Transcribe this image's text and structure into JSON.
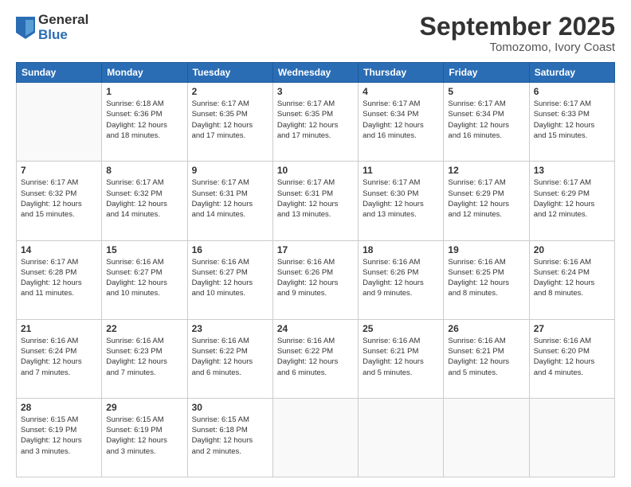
{
  "header": {
    "logo_general": "General",
    "logo_blue": "Blue",
    "month_title": "September 2025",
    "location": "Tomozomo, Ivory Coast"
  },
  "days_of_week": [
    "Sunday",
    "Monday",
    "Tuesday",
    "Wednesday",
    "Thursday",
    "Friday",
    "Saturday"
  ],
  "weeks": [
    [
      {
        "day": "",
        "detail": ""
      },
      {
        "day": "1",
        "detail": "Sunrise: 6:18 AM\nSunset: 6:36 PM\nDaylight: 12 hours\nand 18 minutes."
      },
      {
        "day": "2",
        "detail": "Sunrise: 6:17 AM\nSunset: 6:35 PM\nDaylight: 12 hours\nand 17 minutes."
      },
      {
        "day": "3",
        "detail": "Sunrise: 6:17 AM\nSunset: 6:35 PM\nDaylight: 12 hours\nand 17 minutes."
      },
      {
        "day": "4",
        "detail": "Sunrise: 6:17 AM\nSunset: 6:34 PM\nDaylight: 12 hours\nand 16 minutes."
      },
      {
        "day": "5",
        "detail": "Sunrise: 6:17 AM\nSunset: 6:34 PM\nDaylight: 12 hours\nand 16 minutes."
      },
      {
        "day": "6",
        "detail": "Sunrise: 6:17 AM\nSunset: 6:33 PM\nDaylight: 12 hours\nand 15 minutes."
      }
    ],
    [
      {
        "day": "7",
        "detail": "Sunrise: 6:17 AM\nSunset: 6:32 PM\nDaylight: 12 hours\nand 15 minutes."
      },
      {
        "day": "8",
        "detail": "Sunrise: 6:17 AM\nSunset: 6:32 PM\nDaylight: 12 hours\nand 14 minutes."
      },
      {
        "day": "9",
        "detail": "Sunrise: 6:17 AM\nSunset: 6:31 PM\nDaylight: 12 hours\nand 14 minutes."
      },
      {
        "day": "10",
        "detail": "Sunrise: 6:17 AM\nSunset: 6:31 PM\nDaylight: 12 hours\nand 13 minutes."
      },
      {
        "day": "11",
        "detail": "Sunrise: 6:17 AM\nSunset: 6:30 PM\nDaylight: 12 hours\nand 13 minutes."
      },
      {
        "day": "12",
        "detail": "Sunrise: 6:17 AM\nSunset: 6:29 PM\nDaylight: 12 hours\nand 12 minutes."
      },
      {
        "day": "13",
        "detail": "Sunrise: 6:17 AM\nSunset: 6:29 PM\nDaylight: 12 hours\nand 12 minutes."
      }
    ],
    [
      {
        "day": "14",
        "detail": "Sunrise: 6:17 AM\nSunset: 6:28 PM\nDaylight: 12 hours\nand 11 minutes."
      },
      {
        "day": "15",
        "detail": "Sunrise: 6:16 AM\nSunset: 6:27 PM\nDaylight: 12 hours\nand 10 minutes."
      },
      {
        "day": "16",
        "detail": "Sunrise: 6:16 AM\nSunset: 6:27 PM\nDaylight: 12 hours\nand 10 minutes."
      },
      {
        "day": "17",
        "detail": "Sunrise: 6:16 AM\nSunset: 6:26 PM\nDaylight: 12 hours\nand 9 minutes."
      },
      {
        "day": "18",
        "detail": "Sunrise: 6:16 AM\nSunset: 6:26 PM\nDaylight: 12 hours\nand 9 minutes."
      },
      {
        "day": "19",
        "detail": "Sunrise: 6:16 AM\nSunset: 6:25 PM\nDaylight: 12 hours\nand 8 minutes."
      },
      {
        "day": "20",
        "detail": "Sunrise: 6:16 AM\nSunset: 6:24 PM\nDaylight: 12 hours\nand 8 minutes."
      }
    ],
    [
      {
        "day": "21",
        "detail": "Sunrise: 6:16 AM\nSunset: 6:24 PM\nDaylight: 12 hours\nand 7 minutes."
      },
      {
        "day": "22",
        "detail": "Sunrise: 6:16 AM\nSunset: 6:23 PM\nDaylight: 12 hours\nand 7 minutes."
      },
      {
        "day": "23",
        "detail": "Sunrise: 6:16 AM\nSunset: 6:22 PM\nDaylight: 12 hours\nand 6 minutes."
      },
      {
        "day": "24",
        "detail": "Sunrise: 6:16 AM\nSunset: 6:22 PM\nDaylight: 12 hours\nand 6 minutes."
      },
      {
        "day": "25",
        "detail": "Sunrise: 6:16 AM\nSunset: 6:21 PM\nDaylight: 12 hours\nand 5 minutes."
      },
      {
        "day": "26",
        "detail": "Sunrise: 6:16 AM\nSunset: 6:21 PM\nDaylight: 12 hours\nand 5 minutes."
      },
      {
        "day": "27",
        "detail": "Sunrise: 6:16 AM\nSunset: 6:20 PM\nDaylight: 12 hours\nand 4 minutes."
      }
    ],
    [
      {
        "day": "28",
        "detail": "Sunrise: 6:15 AM\nSunset: 6:19 PM\nDaylight: 12 hours\nand 3 minutes."
      },
      {
        "day": "29",
        "detail": "Sunrise: 6:15 AM\nSunset: 6:19 PM\nDaylight: 12 hours\nand 3 minutes."
      },
      {
        "day": "30",
        "detail": "Sunrise: 6:15 AM\nSunset: 6:18 PM\nDaylight: 12 hours\nand 2 minutes."
      },
      {
        "day": "",
        "detail": ""
      },
      {
        "day": "",
        "detail": ""
      },
      {
        "day": "",
        "detail": ""
      },
      {
        "day": "",
        "detail": ""
      }
    ]
  ]
}
